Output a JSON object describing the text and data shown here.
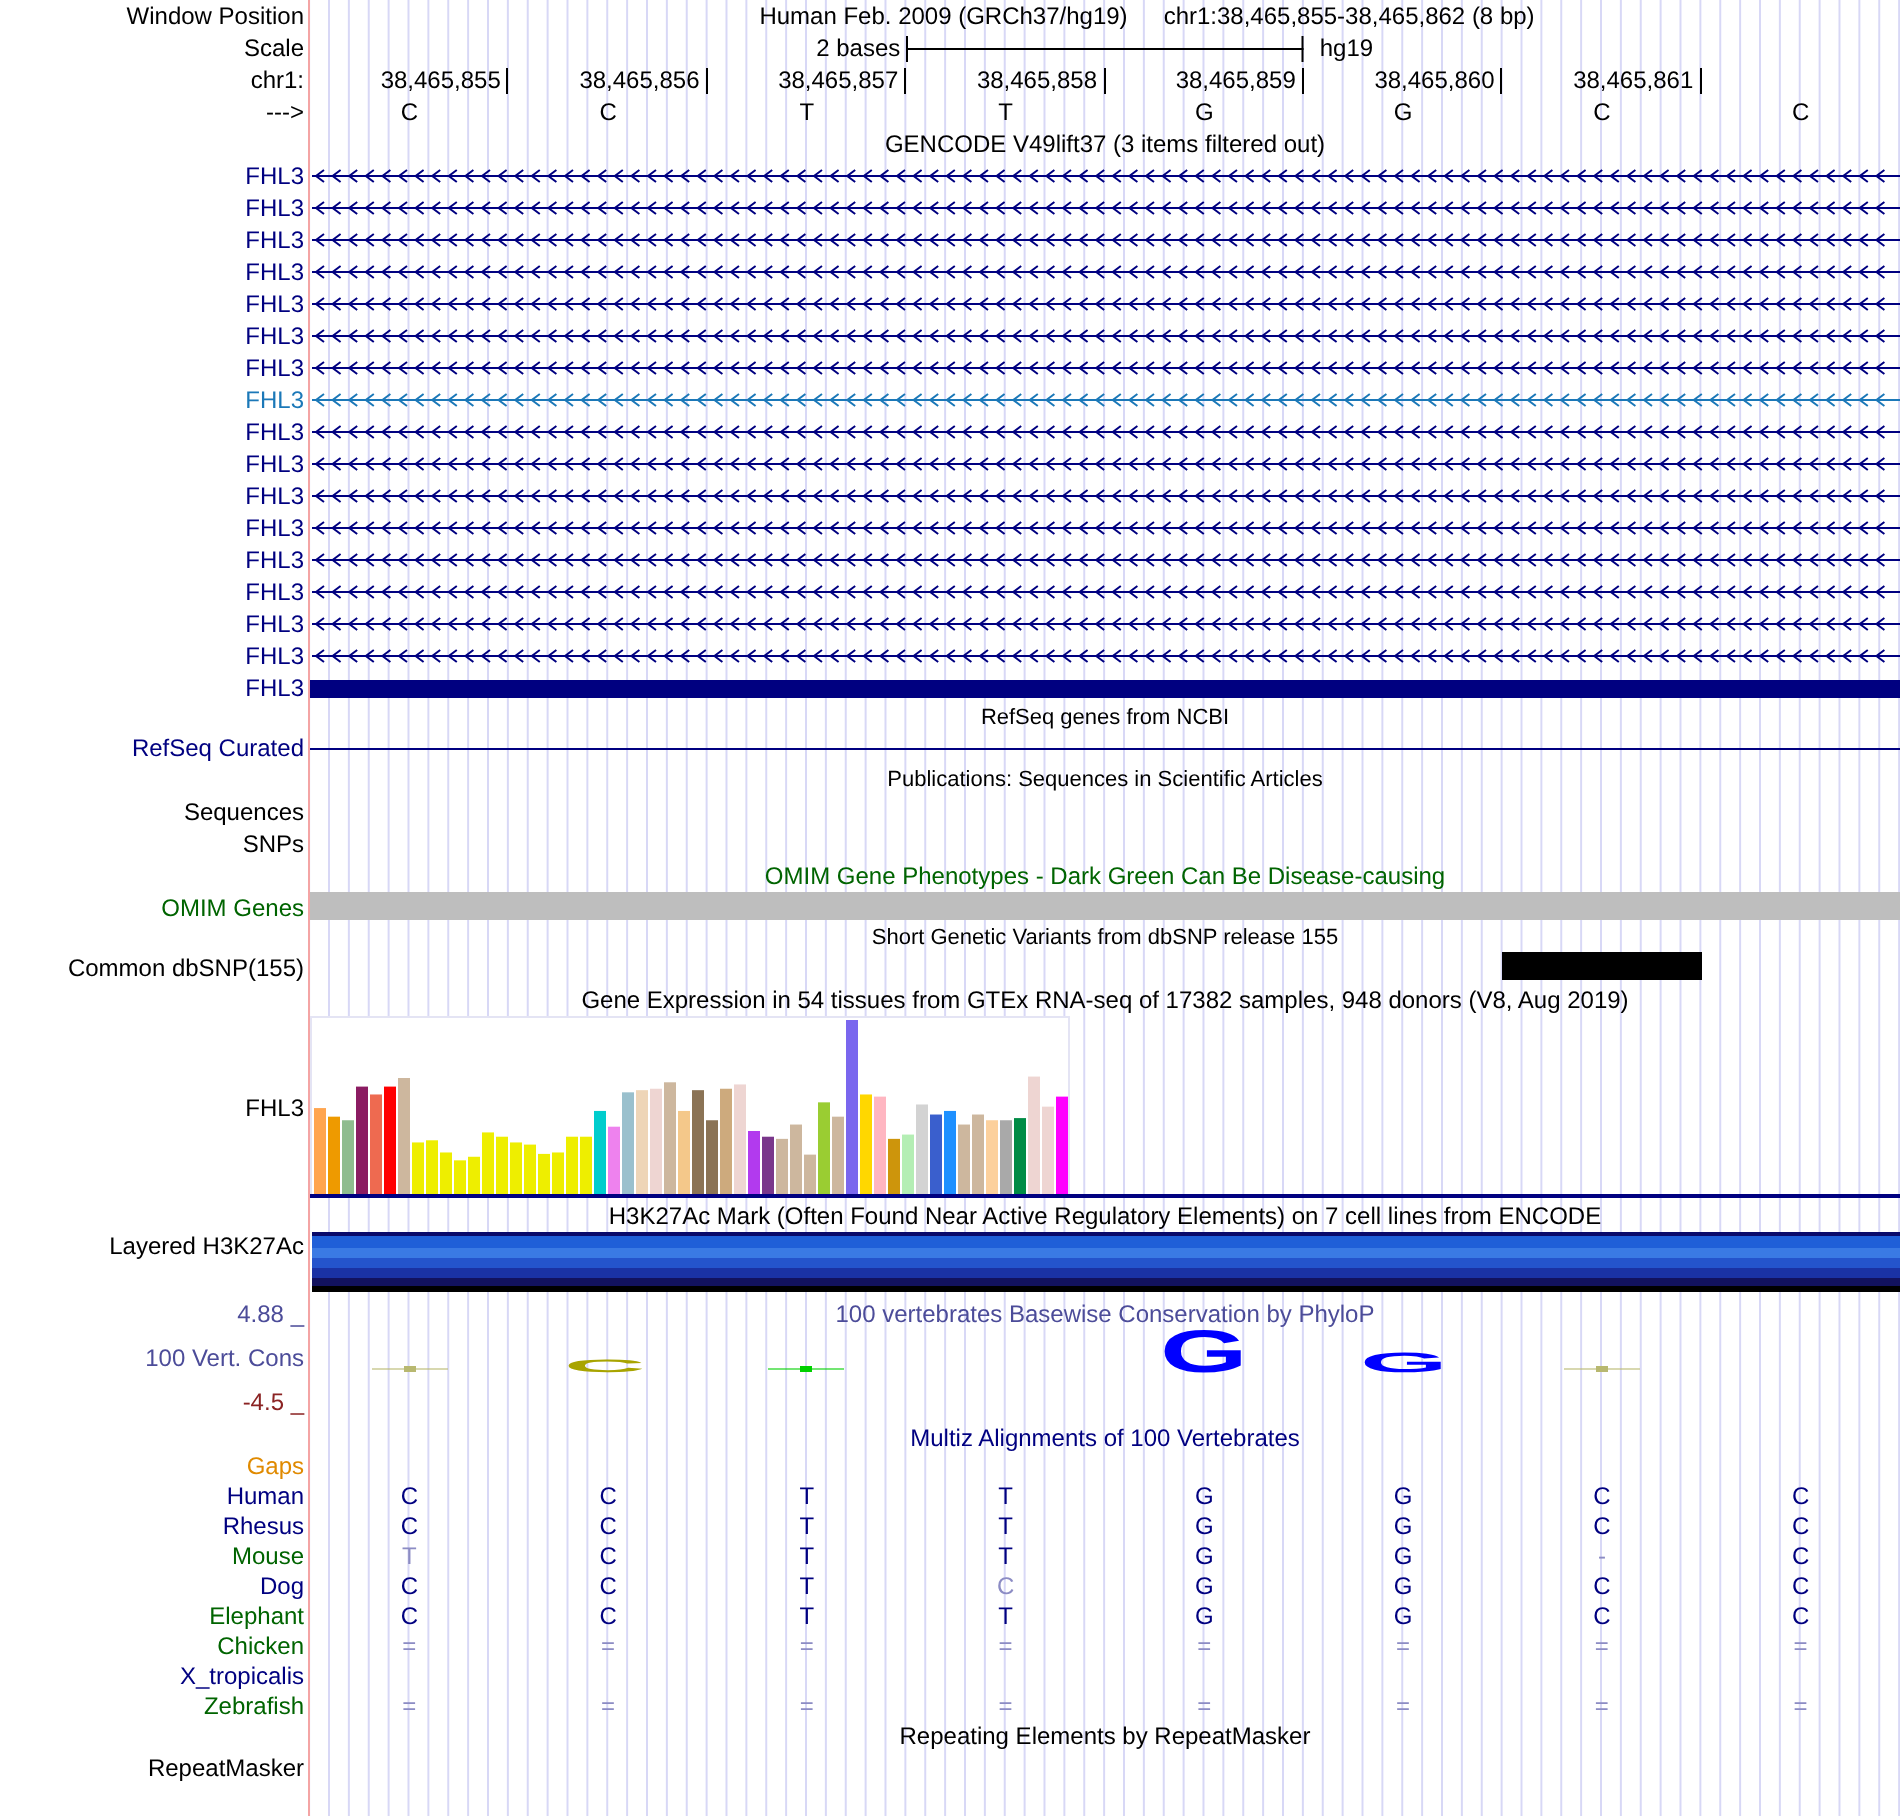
{
  "header": {
    "window_label": "Window Position",
    "assembly_title": "Human Feb. 2009 (GRCh37/hg19)",
    "position": "chr1:38,465,855-38,465,862 (8 bp)",
    "scale_label": "Scale",
    "scale_text": "2 bases",
    "assembly": "hg19",
    "chrom_label": "chr1:",
    "positions": [
      "38,465,855",
      "38,465,856",
      "38,465,857",
      "38,465,858",
      "38,465,859",
      "38,465,860",
      "38,465,861"
    ],
    "strand_label": "--->",
    "bases": [
      "C",
      "C",
      "T",
      "T",
      "G",
      "G",
      "C",
      "C"
    ]
  },
  "gencode": {
    "title": "GENCODE V49lift37 (3 items filtered out)",
    "genes": [
      {
        "label": "FHL3",
        "kind": "intron",
        "highlighted": false
      },
      {
        "label": "FHL3",
        "kind": "intron",
        "highlighted": false
      },
      {
        "label": "FHL3",
        "kind": "intron",
        "highlighted": false
      },
      {
        "label": "FHL3",
        "kind": "intron",
        "highlighted": false
      },
      {
        "label": "FHL3",
        "kind": "intron",
        "highlighted": false
      },
      {
        "label": "FHL3",
        "kind": "intron",
        "highlighted": false
      },
      {
        "label": "FHL3",
        "kind": "intron",
        "highlighted": false
      },
      {
        "label": "FHL3",
        "kind": "intron",
        "highlighted": true
      },
      {
        "label": "FHL3",
        "kind": "intron",
        "highlighted": false
      },
      {
        "label": "FHL3",
        "kind": "intron",
        "highlighted": false
      },
      {
        "label": "FHL3",
        "kind": "intron",
        "highlighted": false
      },
      {
        "label": "FHL3",
        "kind": "intron",
        "highlighted": false
      },
      {
        "label": "FHL3",
        "kind": "intron",
        "highlighted": false
      },
      {
        "label": "FHL3",
        "kind": "intron",
        "highlighted": false
      },
      {
        "label": "FHL3",
        "kind": "intron",
        "highlighted": false
      },
      {
        "label": "FHL3",
        "kind": "intron",
        "highlighted": false
      },
      {
        "label": "FHL3",
        "kind": "exon",
        "highlighted": false
      }
    ]
  },
  "refseq": {
    "title": "RefSeq genes from NCBI",
    "label": "RefSeq Curated"
  },
  "publications": {
    "title": "Publications: Sequences in Scientific Articles",
    "labels": [
      "Sequences",
      "SNPs"
    ]
  },
  "omim": {
    "title": "OMIM Gene Phenotypes - Dark Green Can Be Disease-causing",
    "label": "OMIM Genes"
  },
  "dbsnp": {
    "title": "Short Genetic Variants from dbSNP release 155",
    "label": "Common dbSNP(155)"
  },
  "gtex": {
    "title": "Gene Expression in 54 tissues from GTEx RNA-seq of 17382 samples, 948 donors (V8, Aug 2019)",
    "label": "FHL3"
  },
  "h3k27ac": {
    "title": "H3K27Ac Mark (Often Found Near Active Regulatory Elements) on 7 cell lines from ENCODE",
    "label": "Layered H3K27Ac"
  },
  "phylop": {
    "title": "100 vertebrates Basewise Conservation by PhyloP",
    "label": "100 Vert. Cons",
    "y_max": "4.88 _",
    "y_min": "-4.5 _",
    "glyphs": [
      {
        "kind": "dash",
        "color": "#b8b870"
      },
      {
        "kind": "small",
        "text": "C",
        "color": "#a8a400"
      },
      {
        "kind": "dash",
        "color": "#00d000"
      },
      {
        "kind": "none"
      },
      {
        "kind": "large",
        "text": "G",
        "color": "#0000ff"
      },
      {
        "kind": "medium",
        "text": "G",
        "color": "#0000ff"
      },
      {
        "kind": "dash",
        "color": "#b8b870"
      },
      {
        "kind": "none"
      }
    ]
  },
  "multiz": {
    "title": "Multiz Alignments of 100 Vertebrates",
    "gaps_label": "Gaps",
    "species": [
      {
        "name": "Human",
        "color": "#000080",
        "bases": [
          {
            "text": "C",
            "faded": false
          },
          {
            "text": "C",
            "faded": false
          },
          {
            "text": "T",
            "faded": false
          },
          {
            "text": "T",
            "faded": false
          },
          {
            "text": "G",
            "faded": false
          },
          {
            "text": "G",
            "faded": false
          },
          {
            "text": "C",
            "faded": false
          },
          {
            "text": "C",
            "faded": false
          }
        ]
      },
      {
        "name": "Rhesus",
        "color": "#000080",
        "bases": [
          {
            "text": "C",
            "faded": false
          },
          {
            "text": "C",
            "faded": false
          },
          {
            "text": "T",
            "faded": false
          },
          {
            "text": "T",
            "faded": false
          },
          {
            "text": "G",
            "faded": false
          },
          {
            "text": "G",
            "faded": false
          },
          {
            "text": "C",
            "faded": false
          },
          {
            "text": "C",
            "faded": false
          }
        ]
      },
      {
        "name": "Mouse",
        "color": "#006400",
        "bases": [
          {
            "text": "T",
            "faded": true
          },
          {
            "text": "C",
            "faded": false
          },
          {
            "text": "T",
            "faded": false
          },
          {
            "text": "T",
            "faded": false
          },
          {
            "text": "G",
            "faded": false
          },
          {
            "text": "G",
            "faded": false
          },
          {
            "text": "-",
            "faded": true
          },
          {
            "text": "C",
            "faded": false
          }
        ]
      },
      {
        "name": "Dog",
        "color": "#000080",
        "bases": [
          {
            "text": "C",
            "faded": false
          },
          {
            "text": "C",
            "faded": false
          },
          {
            "text": "T",
            "faded": false
          },
          {
            "text": "C",
            "faded": true
          },
          {
            "text": "G",
            "faded": false
          },
          {
            "text": "G",
            "faded": false
          },
          {
            "text": "C",
            "faded": false
          },
          {
            "text": "C",
            "faded": false
          }
        ]
      },
      {
        "name": "Elephant",
        "color": "#006400",
        "bases": [
          {
            "text": "C",
            "faded": false
          },
          {
            "text": "C",
            "faded": false
          },
          {
            "text": "T",
            "faded": false
          },
          {
            "text": "T",
            "faded": false
          },
          {
            "text": "G",
            "faded": false
          },
          {
            "text": "G",
            "faded": false
          },
          {
            "text": "C",
            "faded": false
          },
          {
            "text": "C",
            "faded": false
          }
        ]
      },
      {
        "name": "Chicken",
        "color": "#006400",
        "bases": [
          {
            "text": "=",
            "faded": true
          },
          {
            "text": "=",
            "faded": true
          },
          {
            "text": "=",
            "faded": true
          },
          {
            "text": "=",
            "faded": true
          },
          {
            "text": "=",
            "faded": true
          },
          {
            "text": "=",
            "faded": true
          },
          {
            "text": "=",
            "faded": true
          },
          {
            "text": "=",
            "faded": true
          }
        ]
      },
      {
        "name": "X_tropicalis",
        "color": "#000080"
      },
      {
        "name": "Zebrafish",
        "color": "#006400",
        "bases": [
          {
            "text": "=",
            "faded": true
          },
          {
            "text": "=",
            "faded": true
          },
          {
            "text": "=",
            "faded": true
          },
          {
            "text": "=",
            "faded": true
          },
          {
            "text": "=",
            "faded": true
          },
          {
            "text": "=",
            "faded": true
          },
          {
            "text": "=",
            "faded": true
          },
          {
            "text": "=",
            "faded": true
          }
        ]
      }
    ]
  },
  "repeatmasker": {
    "title": "Repeating Elements by RepeatMasker",
    "label": "RepeatMasker"
  }
}
